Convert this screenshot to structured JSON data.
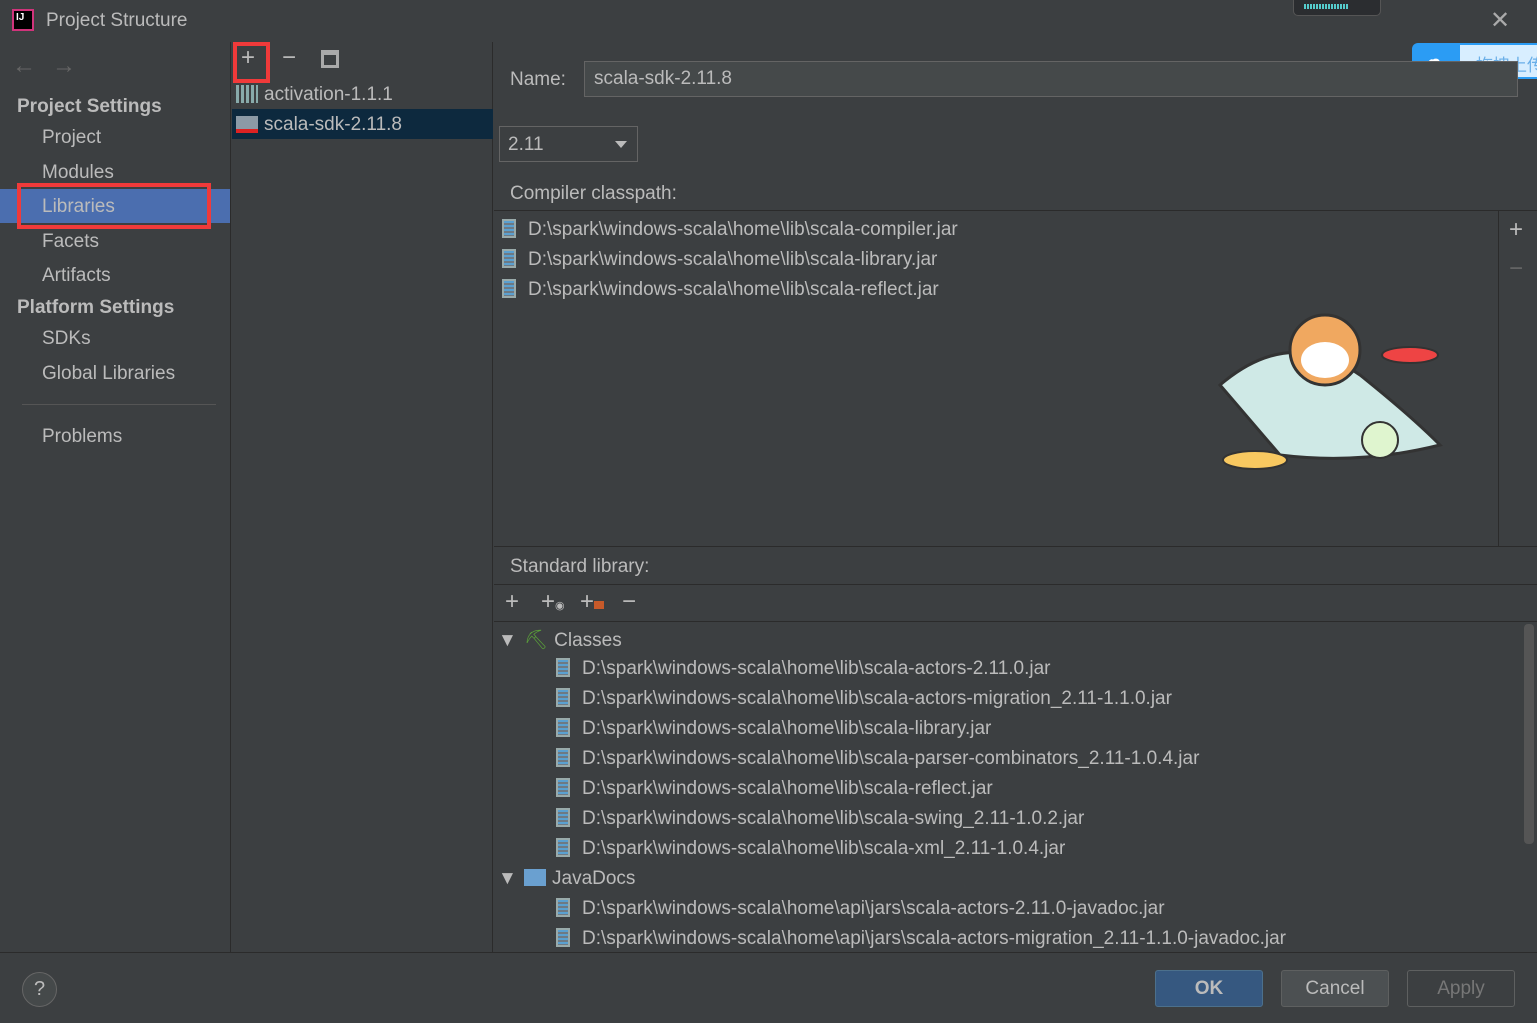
{
  "window": {
    "title": "Project Structure",
    "logo_text": "IJ"
  },
  "sidebar": {
    "nav_back": "←",
    "nav_forward": "→",
    "project_settings": "Project Settings",
    "project_items": [
      "Project",
      "Modules",
      "Libraries",
      "Facets",
      "Artifacts"
    ],
    "platform_settings": "Platform Settings",
    "platform_items": [
      "SDKs",
      "Global Libraries"
    ],
    "problems": "Problems",
    "selected": "Libraries"
  },
  "libraries": {
    "toolbar": {
      "add": "+",
      "remove": "−"
    },
    "items": [
      "activation-1.1.1",
      "scala-sdk-2.11.8"
    ],
    "selected": "scala-sdk-2.11.8"
  },
  "detail": {
    "name_label": "Name:",
    "name_value": "scala-sdk-2.11.8",
    "version": "2.11",
    "compiler_label": "Compiler classpath:",
    "compiler_items": [
      "D:\\spark\\windows-scala\\home\\lib\\scala-compiler.jar",
      "D:\\spark\\windows-scala\\home\\lib\\scala-library.jar",
      "D:\\spark\\windows-scala\\home\\lib\\scala-reflect.jar"
    ],
    "std_label": "Standard library:",
    "classes_label": "Classes",
    "classes": [
      "D:\\spark\\windows-scala\\home\\lib\\scala-actors-2.11.0.jar",
      "D:\\spark\\windows-scala\\home\\lib\\scala-actors-migration_2.11-1.1.0.jar",
      "D:\\spark\\windows-scala\\home\\lib\\scala-library.jar",
      "D:\\spark\\windows-scala\\home\\lib\\scala-parser-combinators_2.11-1.0.4.jar",
      "D:\\spark\\windows-scala\\home\\lib\\scala-reflect.jar",
      "D:\\spark\\windows-scala\\home\\lib\\scala-swing_2.11-1.0.2.jar",
      "D:\\spark\\windows-scala\\home\\lib\\scala-xml_2.11-1.0.4.jar"
    ],
    "javadocs_label": "JavaDocs",
    "javadocs": [
      "D:\\spark\\windows-scala\\home\\api\\jars\\scala-actors-2.11.0-javadoc.jar",
      "D:\\spark\\windows-scala\\home\\api\\jars\\scala-actors-migration_2.11-1.1.0-javadoc.jar"
    ]
  },
  "buttons": {
    "ok": "OK",
    "cancel": "Cancel",
    "apply": "Apply",
    "help": "?"
  },
  "overlay": {
    "upload_text": "拖拽上传"
  },
  "colors": {
    "selection": "#4b6eaf",
    "highlight": "#f03a3a",
    "list_selection": "#0d293e"
  }
}
